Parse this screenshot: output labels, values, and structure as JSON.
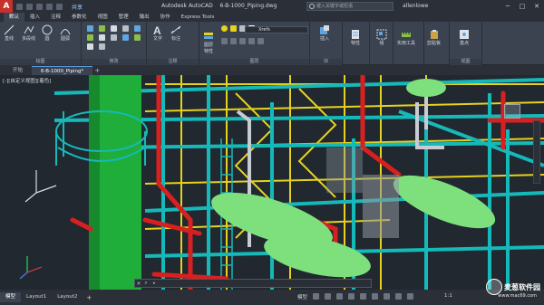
{
  "titlebar": {
    "app_title": "Autodesk AutoCAD",
    "document_title": "6-B-1000_Piping.dwg",
    "share_label": "共享",
    "search_placeholder": "键入关键字或短语",
    "username": "allenlowe",
    "logo": "A"
  },
  "ribbon_tabs": [
    "默认",
    "插入",
    "注释",
    "参数化",
    "视图",
    "管理",
    "输出",
    "协作",
    "Express Tools"
  ],
  "ribbon": {
    "draw": {
      "tools": [
        "直线",
        "多段线",
        "圆",
        "圆弧"
      ],
      "title": "绘图"
    },
    "modify": {
      "title": "修改"
    },
    "annotation": {
      "tools": [
        "文字",
        "标注"
      ],
      "title": "注释"
    },
    "layers": {
      "properties_label": "图层\n特性",
      "current_layer": "Xrefs",
      "title": "图层"
    },
    "block": {
      "insert_label": "插入",
      "title": "块"
    },
    "properties": {
      "match_label": "特性",
      "title": ""
    },
    "groups": {
      "label": "组"
    },
    "utilities": {
      "label": "实用工具"
    },
    "clipboard": {
      "label": "剪贴板"
    },
    "view": {
      "base_label": "基点",
      "title": "视图"
    }
  },
  "doc_tabs": [
    "开始",
    "6-B-1000_Piping*"
  ],
  "viewport": {
    "label": "[-][自定义视图][着色]"
  },
  "layout_tabs": [
    "模型",
    "Layout1",
    "Layout2"
  ],
  "status": {
    "model_label": "模型",
    "scale": "1:1"
  },
  "watermark": {
    "text": "麦葱软件园",
    "subtext": "www.mac69.com"
  },
  "colors": {
    "pipe_green": "#1fae3a",
    "pipe_red": "#d92020",
    "structure_cyan": "#16b9b9",
    "structure_yellow": "#e6d21e",
    "vessel_green": "#7de07d",
    "accent": "#5b9bd5"
  }
}
